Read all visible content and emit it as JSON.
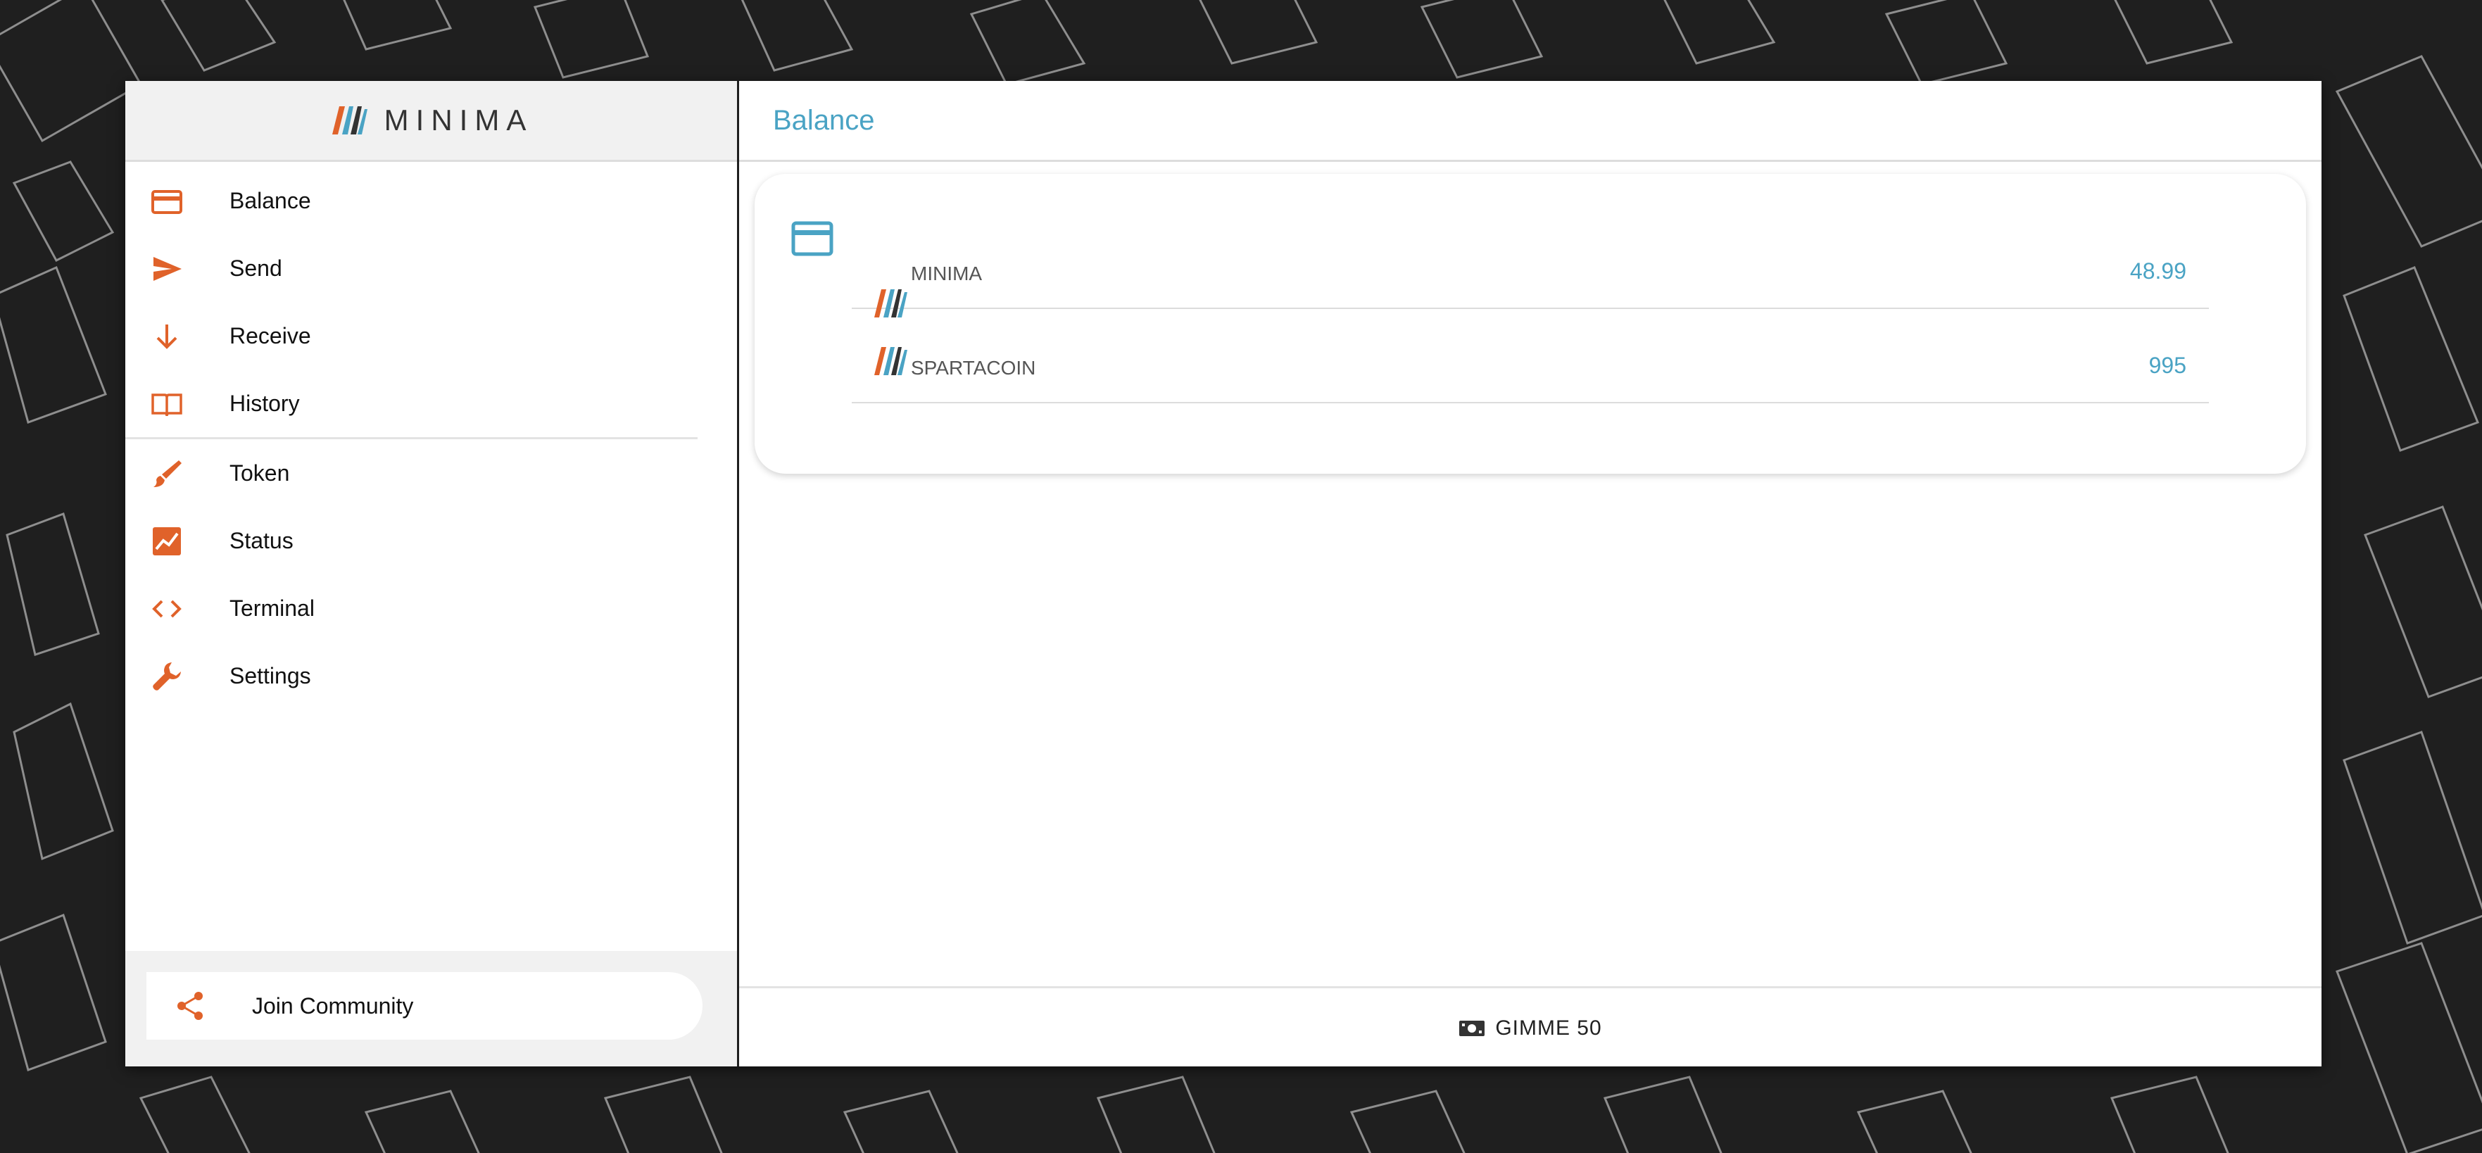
{
  "brand": {
    "name": "MINIMA"
  },
  "colors": {
    "accent_orange": "#e0622a",
    "accent_blue": "#4aa3c4",
    "background": "#1f1f1f"
  },
  "sidebar": {
    "items": [
      {
        "label": "Balance",
        "icon": "credit-card-icon"
      },
      {
        "label": "Send",
        "icon": "send-icon"
      },
      {
        "label": "Receive",
        "icon": "arrow-down-icon"
      },
      {
        "label": "History",
        "icon": "book-icon"
      },
      {
        "label": "Token",
        "icon": "brush-icon"
      },
      {
        "label": "Status",
        "icon": "chart-icon"
      },
      {
        "label": "Terminal",
        "icon": "code-icon"
      },
      {
        "label": "Settings",
        "icon": "wrench-icon"
      }
    ],
    "footer": {
      "label": "Join Community",
      "icon": "share-icon"
    }
  },
  "main": {
    "title": "Balance",
    "card_icon": "credit-card-icon",
    "tokens": [
      {
        "name": "MINIMA",
        "amount": "48.99"
      },
      {
        "name": "SPARTACOIN",
        "amount": "995"
      }
    ],
    "footer_button": {
      "label": "GIMME 50",
      "icon": "money-icon"
    }
  }
}
